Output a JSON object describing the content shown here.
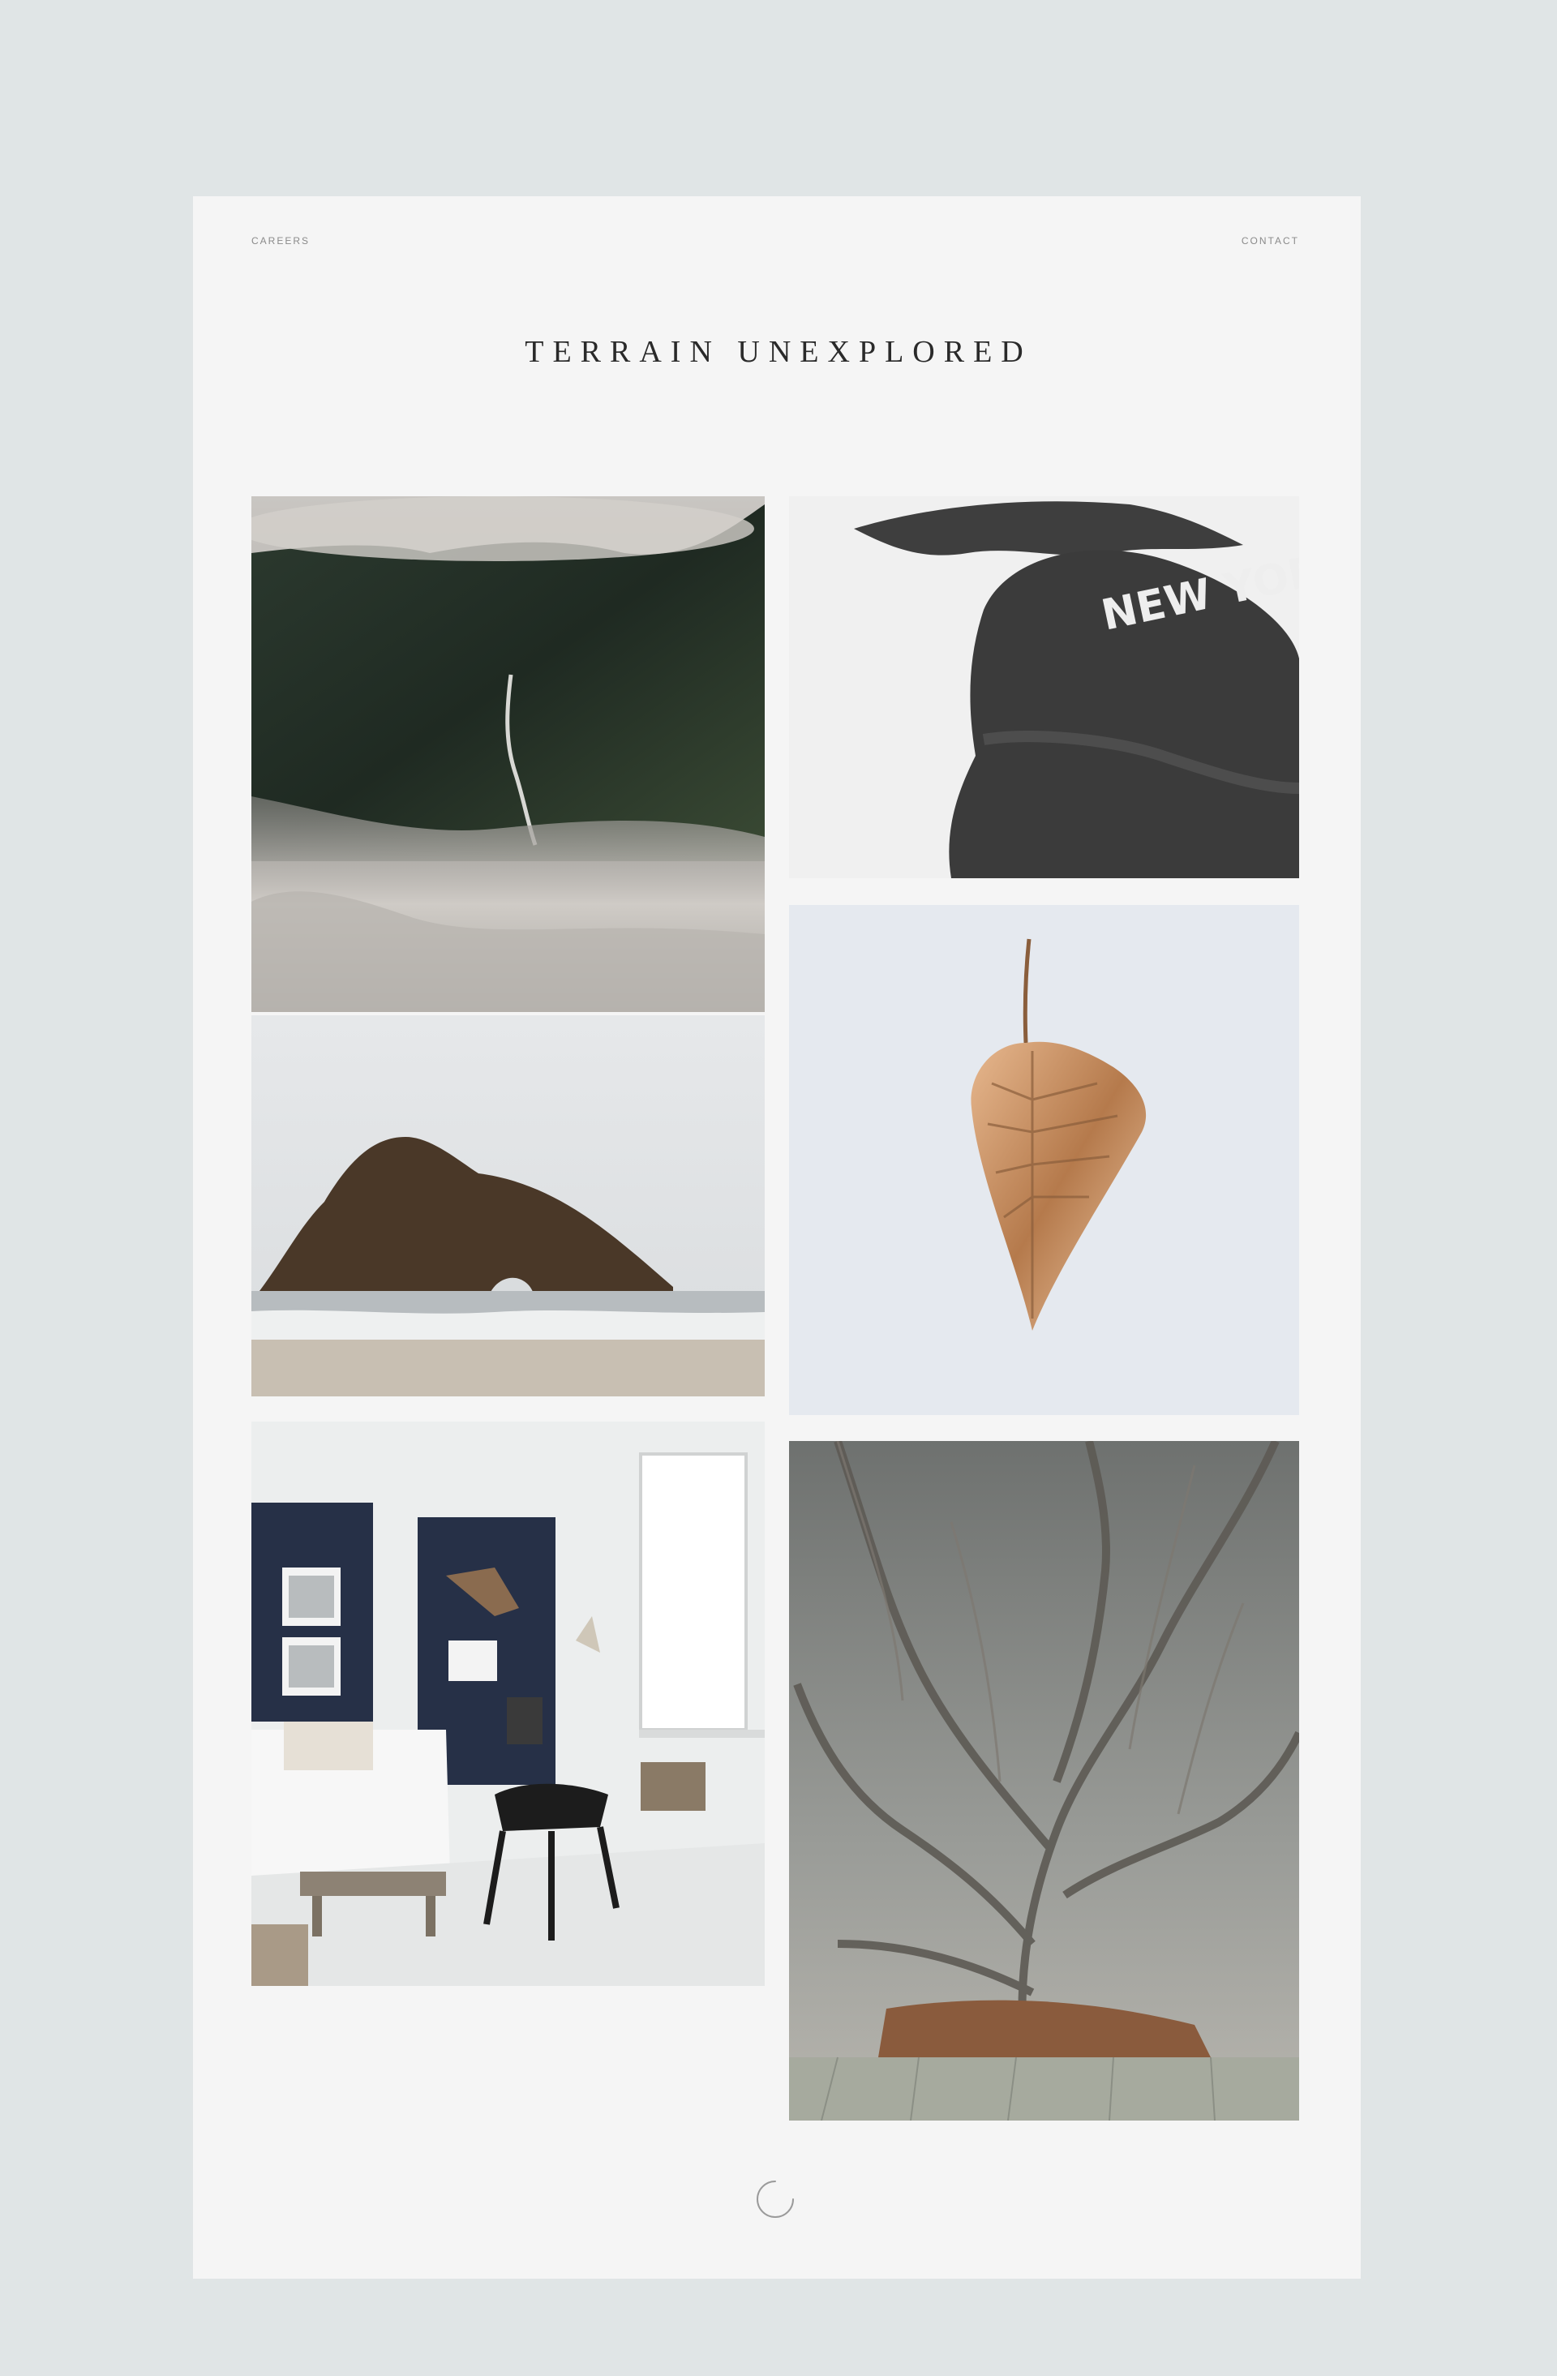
{
  "nav": {
    "careers_label": "CAREERS",
    "contact_label": "CONTACT"
  },
  "site": {
    "title": "TERRAIN UNEXPLORED"
  },
  "gallery": {
    "photos": [
      {
        "name": "waterfall-cliffs-photo"
      },
      {
        "name": "sea-arch-rock-photo"
      },
      {
        "name": "living-room-interior-photo"
      },
      {
        "name": "new-york-sweatshirt-photo",
        "text": "NEW YORK"
      },
      {
        "name": "gold-leaf-photo"
      },
      {
        "name": "vine-covered-wall-photo"
      }
    ]
  },
  "colors": {
    "background": "#e0e5e6",
    "card": "#f5f5f5",
    "title": "#2a2a2a",
    "nav": "#8a8a8a"
  },
  "loader": {
    "icon": "loading-spinner-icon"
  }
}
